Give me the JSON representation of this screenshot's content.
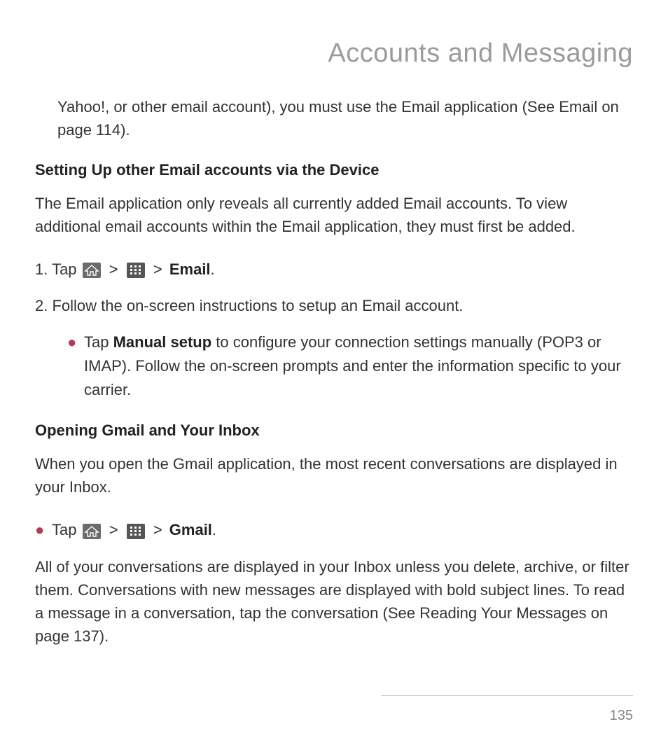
{
  "header": {
    "title": "Accounts and Messaging"
  },
  "intro": {
    "text": "Yahoo!, or other email account), you must use the Email application (See Email on page 114)."
  },
  "section1": {
    "heading": "Setting Up other Email accounts via the Device",
    "para": "The Email application only reveals all currently added Email accounts. To view additional email accounts within the Email application, they must first be added.",
    "step1_prefix": "1. Tap ",
    "step1_sep": " > ",
    "step1_email": "Email",
    "step1_period": ".",
    "step2": "2. Follow the on-screen instructions to setup an Email account.",
    "bullet_prefix": "Tap ",
    "bullet_bold": "Manual setup",
    "bullet_rest": " to configure your connection settings manually (POP3 or IMAP). Follow the on-screen prompts and enter the information specific to your carrier."
  },
  "section2": {
    "heading": "Opening Gmail and Your Inbox",
    "para": "When you open the Gmail application, the most recent conversations are displayed in your Inbox.",
    "bullet_prefix": "Tap ",
    "bullet_sep": " > ",
    "bullet_gmail": "Gmail",
    "bullet_period": ".",
    "closing": "All of your conversations are displayed in your Inbox unless you delete, archive, or filter them. Conversations with new messages are displayed with bold subject lines. To read a message in a conversation, tap the conversation (See Reading Your Messages on page 137)."
  },
  "footer": {
    "page_number": "135"
  }
}
